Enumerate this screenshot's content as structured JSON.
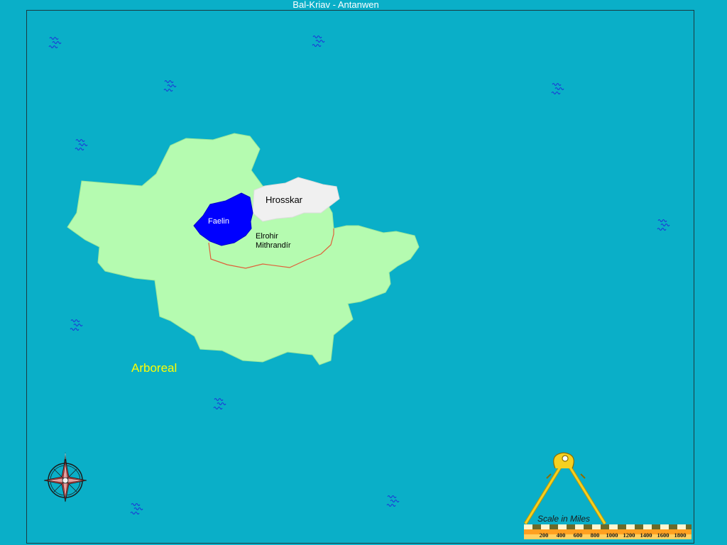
{
  "map": {
    "title": "Bal-Kriav - Antanwen",
    "regions": {
      "faelin": "Faelin",
      "hrosskar": "Hrosskar",
      "elrohir": "Elrohir",
      "mithrandir": "Mithrandír",
      "arboreal": "Arboreal"
    },
    "scale": {
      "label": "Scale in Miles",
      "ticks": [
        "200",
        "400",
        "600",
        "800",
        "1000",
        "1200",
        "1400",
        "1600",
        "1800"
      ]
    },
    "colors": {
      "ocean": "#0aafc8",
      "land": "#b5fbb0",
      "faelin": "#0000ff",
      "hrosskar": "#f0f0f0",
      "border": "#e0603a",
      "arboreal_text": "#ffff00"
    }
  }
}
